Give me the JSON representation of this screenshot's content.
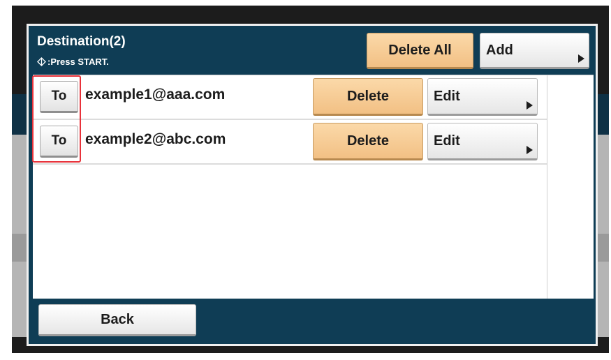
{
  "header": {
    "title": "Destination(2)",
    "hint": ":Press START.",
    "delete_all_label": "Delete All",
    "add_label": "Add"
  },
  "destinations": [
    {
      "type_label": "To",
      "email": "example1@aaa.com",
      "delete_label": "Delete",
      "edit_label": "Edit"
    },
    {
      "type_label": "To",
      "email": "example2@abc.com",
      "delete_label": "Delete",
      "edit_label": "Edit"
    }
  ],
  "footer": {
    "back_label": "Back"
  },
  "colors": {
    "panel": "#0f3d55",
    "orange_button": "#f2c084",
    "highlight": "#e8323a"
  },
  "icons": {
    "start": "start-icon",
    "submenu": "arrow-right-icon"
  }
}
